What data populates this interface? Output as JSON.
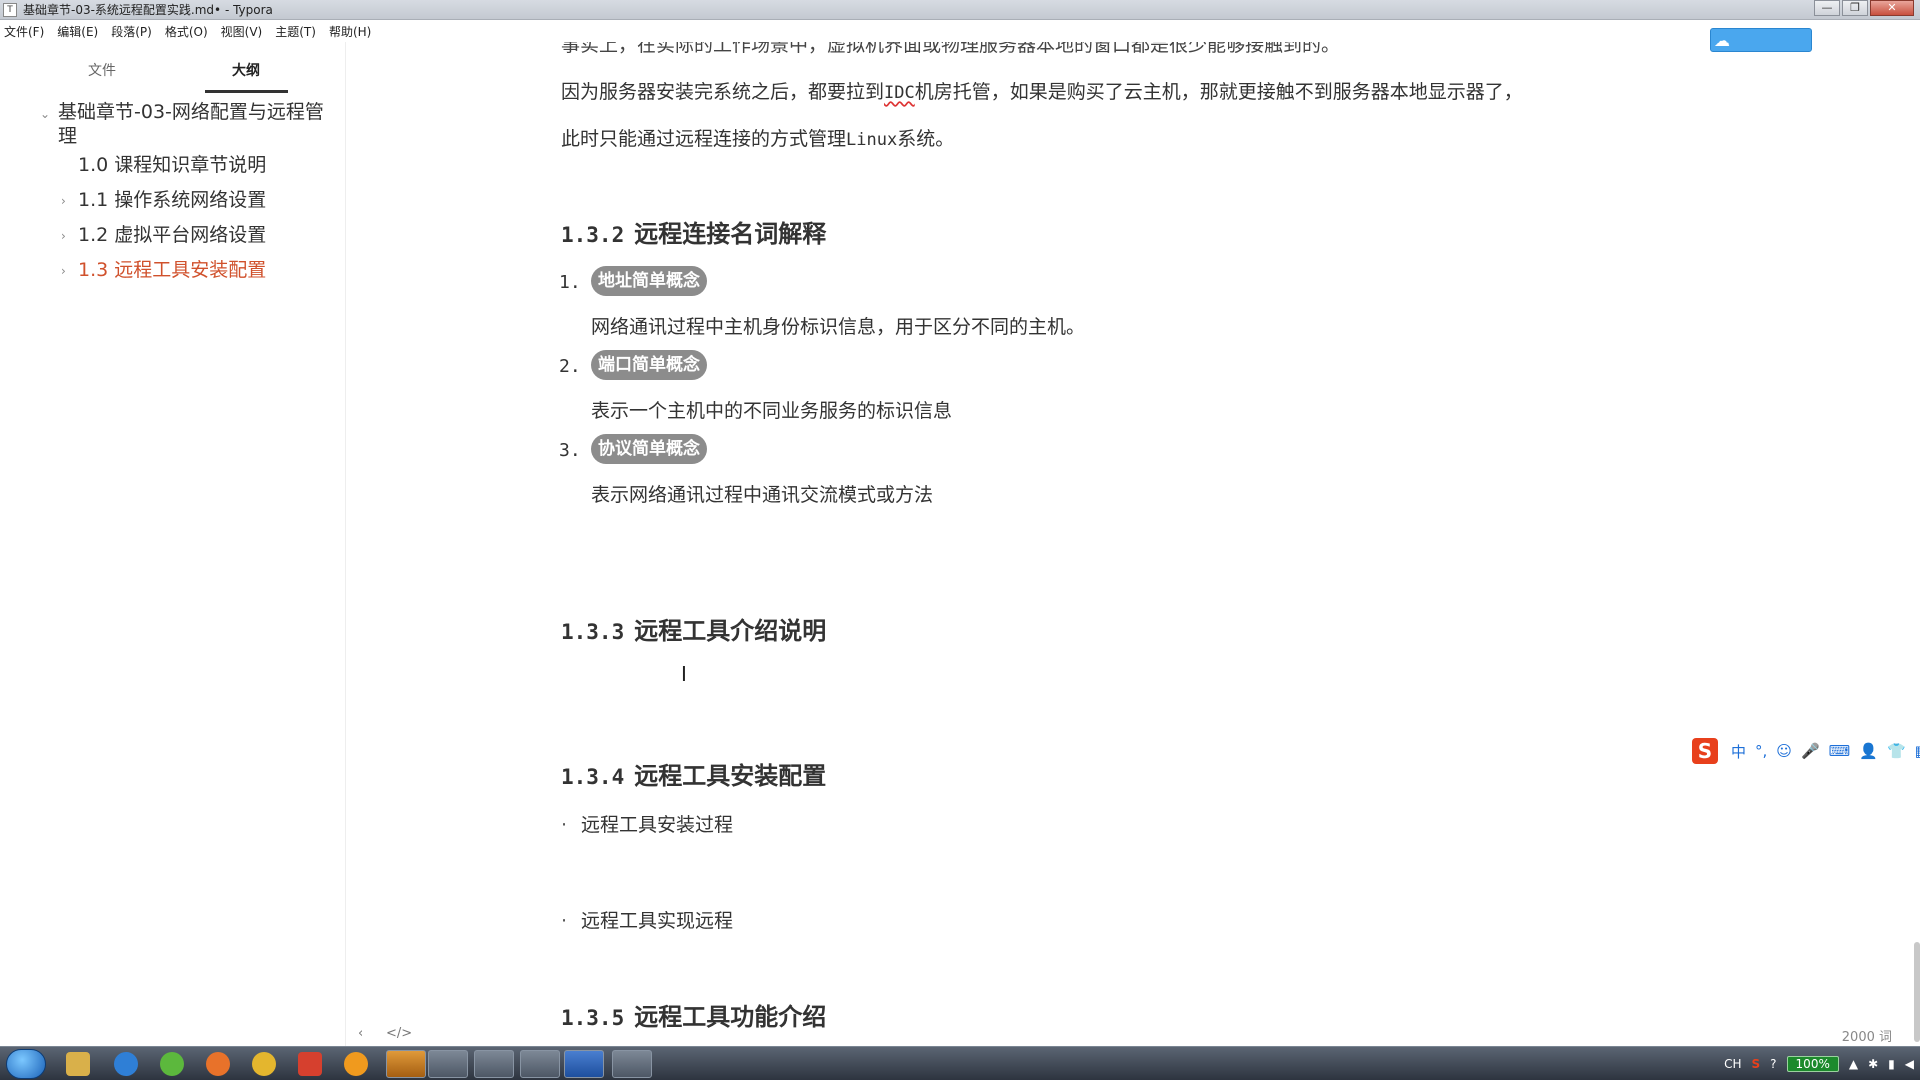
{
  "window": {
    "app_icon": "T",
    "title": "基础章节-03-系统远程配置实践.md• - Typora",
    "controls": {
      "minimize": "—",
      "maximize": "❐",
      "close": "✕"
    }
  },
  "menu": [
    "文件(F)",
    "编辑(E)",
    "段落(P)",
    "格式(O)",
    "视图(V)",
    "主题(T)",
    "帮助(H)"
  ],
  "sidebar": {
    "tab_files": "文件",
    "tab_outline": "大纲",
    "items": [
      {
        "label": "基础章节-03-网络配置与远程管理",
        "toggle": "⌄"
      },
      {
        "label": "1.0 课程知识章节说明",
        "toggle": ""
      },
      {
        "label": "1.1 操作系统网络设置",
        "toggle": "›"
      },
      {
        "label": "1.2 虚拟平台网络设置",
        "toggle": "›"
      },
      {
        "label": "1.3 远程工具安装配置",
        "toggle": "›",
        "active": true
      }
    ],
    "bottom_back": "‹",
    "bottom_source": "</>"
  },
  "content": {
    "top_partial": "事实上，在实际的工作场景中，虚拟机界面或物理服务器本地的窗口都是很少能够接触到的。",
    "para1_a": "因为服务器安装完系统之后，都要拉到",
    "para1_idc": "IDC",
    "para1_b": "机房托管，如果是购买了云主机，那就更接触不到服务器本地显示器了，",
    "para2_a": "此时只能通过远程连接的方式管理",
    "para2_linux": "Linux",
    "para2_b": "系统。",
    "h_132_num": "1.3.2",
    "h_132_text": "远程连接名词解释",
    "list": [
      {
        "num": "1.",
        "chip": "地址简单概念",
        "desc": "网络通讯过程中主机身份标识信息，用于区分不同的主机。"
      },
      {
        "num": "2.",
        "chip": "端口简单概念",
        "desc": "表示一个主机中的不同业务服务的标识信息"
      },
      {
        "num": "3.",
        "chip": "协议简单概念",
        "desc": "表示网络通讯过程中通讯交流模式或方法"
      }
    ],
    "h_133_num": "1.3.3",
    "h_133_text": "远程工具介绍说明",
    "cursor_glyph": "I",
    "h_134_num": "1.3.4",
    "h_134_text": "远程工具安装配置",
    "bullets": [
      "远程工具安装过程",
      "远程工具实现远程"
    ],
    "bullet_glyph": "·",
    "h_135_num": "1.3.5",
    "h_135_text": "远程工具功能介绍",
    "word_count": "2000 词"
  },
  "cloud_button_icon": "cloud-sync-icon",
  "ime": {
    "logo": "S",
    "items": [
      "中",
      "°,",
      "☺",
      "🎤",
      "⌨",
      "👤",
      "👕",
      "▦"
    ]
  },
  "taskbar": {
    "tray": {
      "lang": "CH",
      "battery": "100%"
    }
  },
  "colors": {
    "accent_active": "#d0512c",
    "chip_bg": "#8c8c8c",
    "ime_logo": "#e8401c"
  }
}
